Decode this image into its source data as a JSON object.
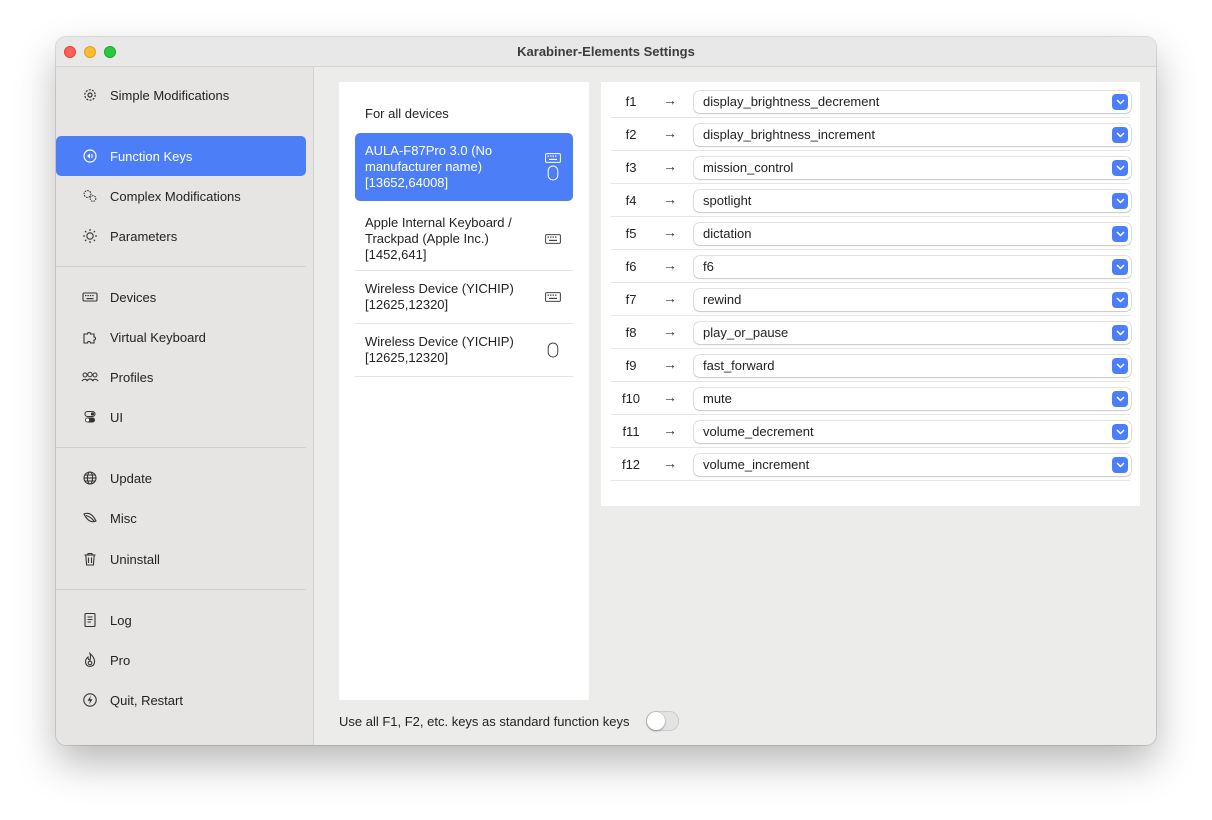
{
  "window": {
    "title": "Karabiner-Elements Settings"
  },
  "sidebar": {
    "items": [
      {
        "label": "Simple Modifications",
        "icon": "gear-icon"
      },
      {
        "label": "Function Keys",
        "icon": "function-keys-icon",
        "active": true
      },
      {
        "label": "Complex Modifications",
        "icon": "gears-icon"
      },
      {
        "label": "Parameters",
        "icon": "sun-icon"
      },
      {
        "label": "Devices",
        "icon": "keyboard-icon"
      },
      {
        "label": "Virtual Keyboard",
        "icon": "puzzle-icon"
      },
      {
        "label": "Profiles",
        "icon": "people-icon"
      },
      {
        "label": "UI",
        "icon": "toggles-icon"
      },
      {
        "label": "Update",
        "icon": "globe-icon"
      },
      {
        "label": "Misc",
        "icon": "leaf-icon"
      },
      {
        "label": "Uninstall",
        "icon": "trash-icon"
      },
      {
        "label": "Log",
        "icon": "doc-icon"
      },
      {
        "label": "Pro",
        "icon": "flame-icon"
      },
      {
        "label": "Quit, Restart",
        "icon": "bolt-icon"
      }
    ]
  },
  "devices": {
    "all_label": "For all devices",
    "items": [
      {
        "name": "AULA-F87Pro 3.0  (No manufacturer name) [13652,64008]",
        "icons": [
          "keyboard-icon",
          "mouse-icon"
        ],
        "selected": true
      },
      {
        "name": "Apple Internal Keyboard / Trackpad (Apple Inc.) [1452,641]",
        "icons": [
          "keyboard-icon"
        ]
      },
      {
        "name": "Wireless Device (YICHIP) [12625,12320]",
        "icons": [
          "keyboard-icon"
        ]
      },
      {
        "name": "Wireless Device (YICHIP) [12625,12320]",
        "icons": [
          "mouse-icon"
        ]
      }
    ]
  },
  "function_keys": {
    "arrow": "→",
    "rows": [
      {
        "key": "f1",
        "value": "display_brightness_decrement"
      },
      {
        "key": "f2",
        "value": "display_brightness_increment"
      },
      {
        "key": "f3",
        "value": "mission_control"
      },
      {
        "key": "f4",
        "value": "spotlight"
      },
      {
        "key": "f5",
        "value": "dictation"
      },
      {
        "key": "f6",
        "value": "f6"
      },
      {
        "key": "f7",
        "value": "rewind"
      },
      {
        "key": "f8",
        "value": "play_or_pause"
      },
      {
        "key": "f9",
        "value": "fast_forward"
      },
      {
        "key": "f10",
        "value": "mute"
      },
      {
        "key": "f11",
        "value": "volume_decrement"
      },
      {
        "key": "f12",
        "value": "volume_increment"
      }
    ]
  },
  "footer": {
    "fn_toggle_label": "Use all F1, F2, etc. keys as standard function keys",
    "fn_toggle_on": false
  },
  "colors": {
    "accent": "#4c7ff7"
  }
}
